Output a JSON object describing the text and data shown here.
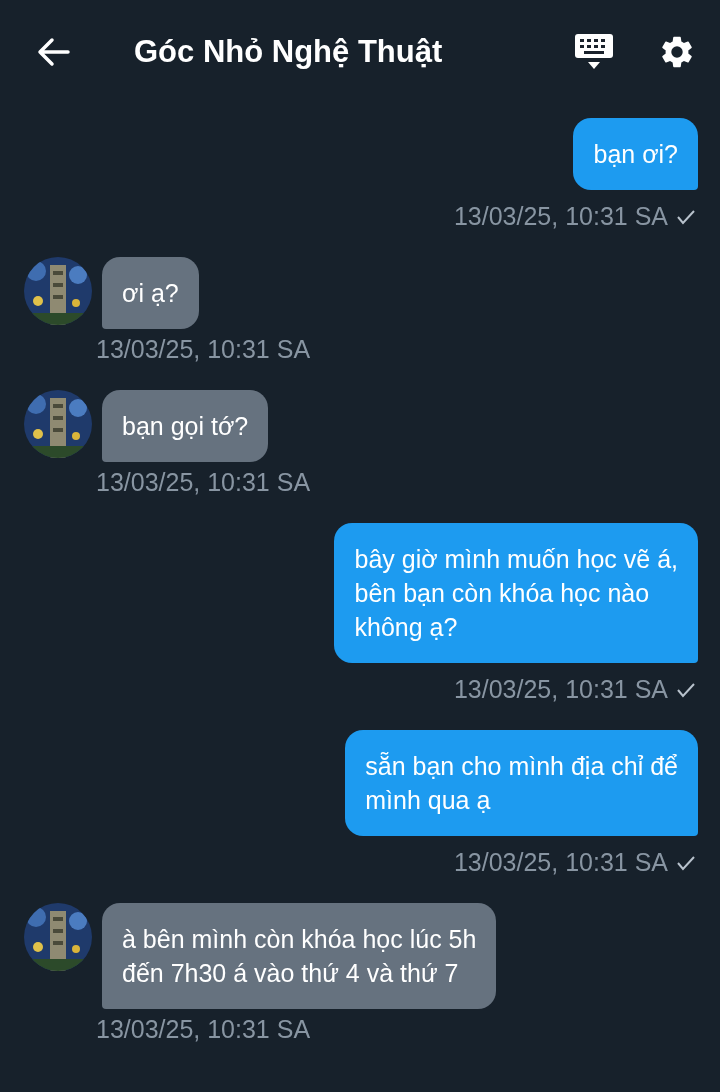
{
  "header": {
    "title": "Góc Nhỏ Nghệ Thuật"
  },
  "messages": [
    {
      "kind": "sent",
      "text": "bạn ơi?",
      "time": "13/03/25, 10:31 SA"
    },
    {
      "kind": "received",
      "text": "ơi ạ?",
      "time": "13/03/25, 10:31 SA"
    },
    {
      "kind": "received",
      "text": "bạn gọi tớ?",
      "time": "13/03/25, 10:31 SA"
    },
    {
      "kind": "sent",
      "text": "bây giờ mình muốn học vẽ á,\nbên bạn còn khóa học nào\nkhông ạ?",
      "time": "13/03/25, 10:31 SA"
    },
    {
      "kind": "sent",
      "text": "sẵn bạn cho mình địa chỉ để\nmình qua ạ",
      "time": "13/03/25, 10:31 SA"
    },
    {
      "kind": "received",
      "text": "à bên mình còn khóa học lúc 5h\nđến 7h30 á vào thứ 4 và thứ 7",
      "time": "13/03/25, 10:31 SA"
    }
  ]
}
